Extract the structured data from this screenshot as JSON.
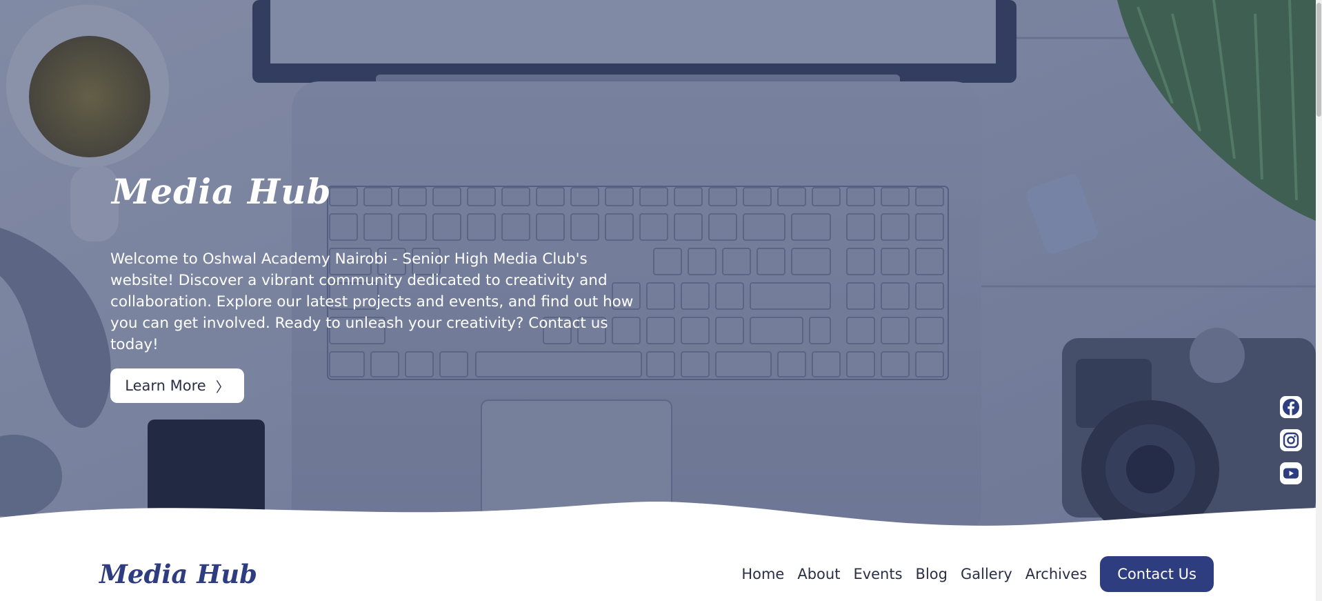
{
  "hero": {
    "title": "Media Hub",
    "text": "Welcome to Oshwal Academy Nairobi - Senior High Media Club's website! Discover a vibrant community dedicated to creativity and collaboration. Explore our latest projects and events, and find out how you can get involved. Ready to unleash your creativity? Contact us today!",
    "button_label": "Learn More",
    "button_icon": "chevron-right-icon"
  },
  "social": [
    {
      "name": "facebook-icon"
    },
    {
      "name": "instagram-icon"
    },
    {
      "name": "youtube-icon"
    }
  ],
  "nav": {
    "brand": "Media Hub",
    "links": [
      "Home",
      "About",
      "Events",
      "Blog",
      "Gallery",
      "Archives"
    ],
    "contact_label": "Contact Us"
  },
  "colors": {
    "brand": "#2e3d80",
    "text_dark": "#2b2f45",
    "hero_text": "#ffffff"
  }
}
